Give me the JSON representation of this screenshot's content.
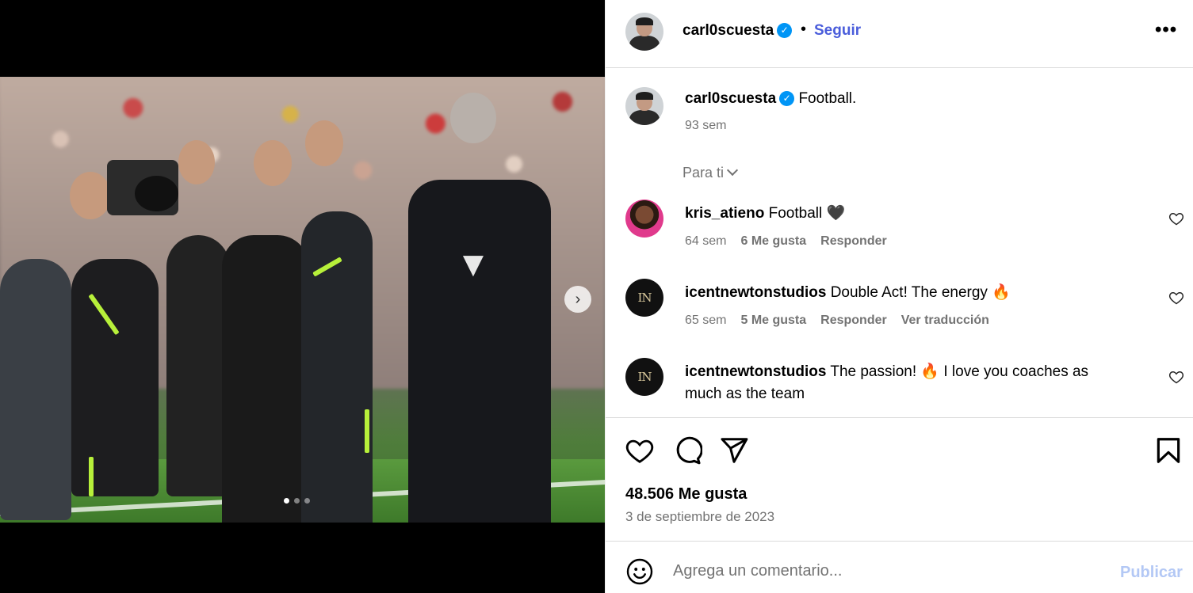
{
  "post": {
    "author": "carl0scuesta",
    "follow_label": "Seguir",
    "separator": "•",
    "more_label": "•••",
    "verified_glyph": "✓",
    "caption": "Football.",
    "caption_time": "93 sem",
    "filter_label": "Para ti",
    "likes": "48.506 Me gusta",
    "date": "3 de septiembre de 2023",
    "carousel": {
      "slides": 3,
      "active_index": 0
    }
  },
  "comments": [
    {
      "user": "kris_atieno",
      "text": "Football 🖤",
      "time": "64 sem",
      "likes": "6 Me gusta",
      "reply": "Responder",
      "translate": ""
    },
    {
      "user": "icentnewtonstudios",
      "text": "Double Act! The energy 🔥",
      "time": "65 sem",
      "likes": "5 Me gusta",
      "reply": "Responder",
      "translate": "Ver traducción"
    },
    {
      "user": "icentnewtonstudios",
      "text": "The passion! 🔥 I love you coaches as much as the team",
      "time": "",
      "likes": "",
      "reply": "",
      "translate": ""
    }
  ],
  "composer": {
    "placeholder": "Agrega un comentario...",
    "publish_label": "Publicar"
  },
  "icons": {
    "like": "heart-icon",
    "comment": "comment-icon",
    "share": "paper-plane-icon",
    "save": "bookmark-icon",
    "emoji": "smiley-icon",
    "next": "chevron-right-icon"
  },
  "colors": {
    "follow": "#4a5ddb",
    "verified": "#0095f6",
    "publish": "#b3c8f5",
    "muted": "#737373"
  }
}
